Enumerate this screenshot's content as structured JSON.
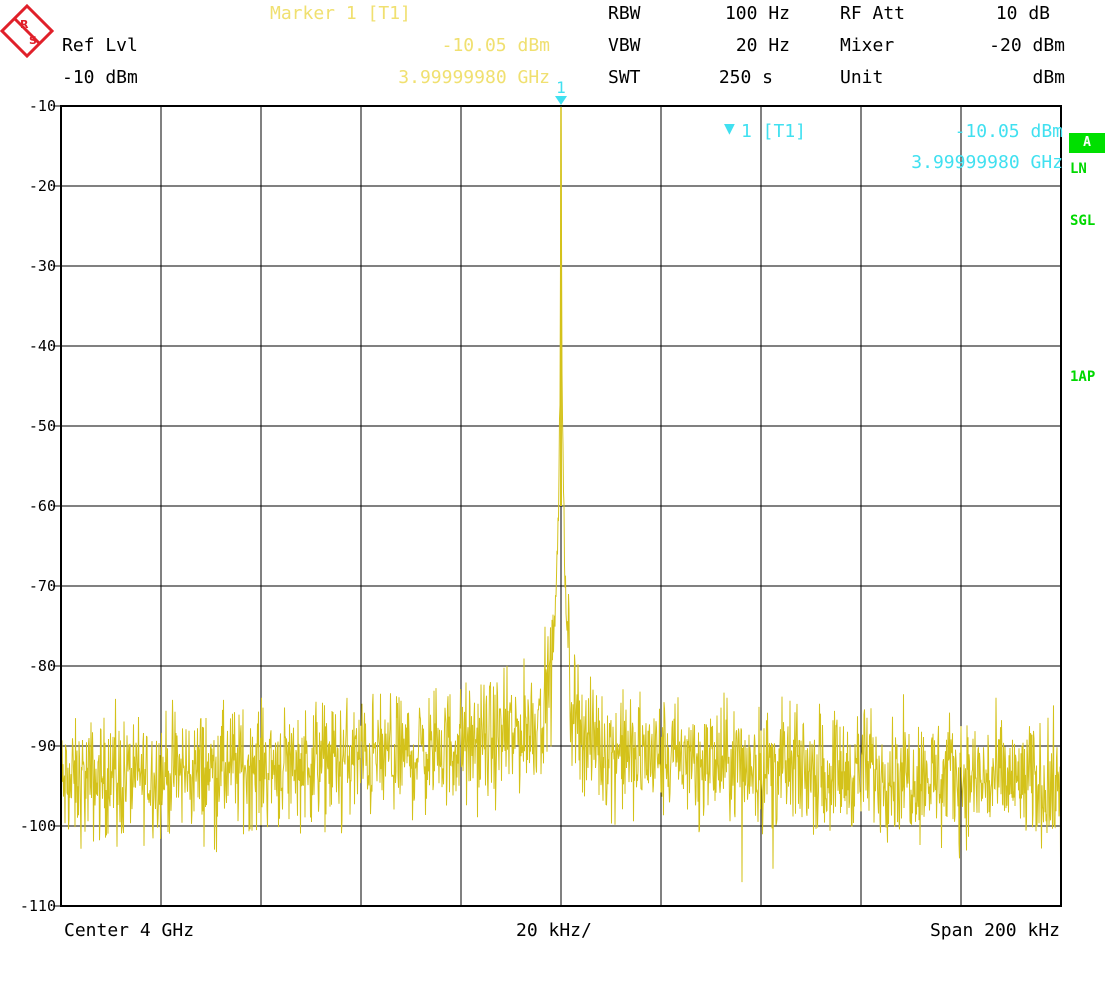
{
  "header": {
    "marker_title": "Marker 1 [T1]",
    "marker_level": "-10.05 dBm",
    "marker_freq": "3.99999980 GHz",
    "ref_lvl_label": "Ref Lvl",
    "ref_lvl_value": "-10 dBm",
    "rbw_label": "RBW",
    "rbw_value": "100 Hz",
    "vbw_label": "VBW",
    "vbw_value": "20 Hz",
    "swt_label": "SWT",
    "swt_value": "250 s",
    "rfatt_label": "RF Att",
    "rfatt_value": "10 dB",
    "mixer_label": "Mixer",
    "mixer_value": "-20 dBm",
    "unit_label": "Unit",
    "unit_value": "dBm"
  },
  "marker_readout": {
    "label": "1 [T1]",
    "level": "-10.05 dBm",
    "freq": "3.99999980 GHz",
    "number": "1"
  },
  "side_labels": {
    "trace_a": "A",
    "ln": "LN",
    "sgl": "SGL",
    "ap": "1AP"
  },
  "footer": {
    "center": "Center 4 GHz",
    "div": "20 kHz/",
    "span": "Span 200 kHz"
  },
  "colors": {
    "trace": "#d4c21a",
    "grid": "#000000",
    "marker": "#40e0f0",
    "header_yellow": "#f0e070",
    "status_green": "#00d800",
    "logo_red": "#e0202a"
  },
  "chart_data": {
    "type": "line",
    "title": "",
    "xlabel": "",
    "ylabel": "",
    "x_unit": "kHz offset from center",
    "xlim": [
      -100,
      100
    ],
    "ylim": [
      -110,
      -10
    ],
    "yticks": [
      -10,
      -20,
      -30,
      -40,
      -50,
      -60,
      -70,
      -80,
      -90,
      -100,
      -110
    ],
    "ytick_labels": [
      "-10",
      "-20",
      "-30",
      "-40",
      "-50",
      "-60",
      "-70",
      "-80",
      "-90",
      "-100",
      "-110"
    ],
    "grid": true,
    "series": [
      {
        "x": [
          -100,
          -90,
          -80,
          -70,
          -60,
          -50,
          -40,
          -30,
          -20,
          -10,
          -5,
          -2,
          -1,
          -0.5,
          -0.2,
          0,
          0.2,
          0.5,
          1,
          2,
          5,
          10,
          20,
          30,
          40,
          50,
          60,
          70,
          80,
          90,
          100
        ],
        "y": [
          -95,
          -94,
          -93.5,
          -93,
          -92.5,
          -92,
          -91.5,
          -91,
          -90,
          -89,
          -87,
          -82,
          -72,
          -60,
          -45,
          -10.05,
          -45,
          -60,
          -72,
          -84,
          -89,
          -90.5,
          -91.5,
          -92,
          -92.5,
          -93,
          -93,
          -93.5,
          -94,
          -94.5,
          -95
        ]
      }
    ],
    "marker": {
      "x": 0,
      "y": -10.05
    }
  }
}
